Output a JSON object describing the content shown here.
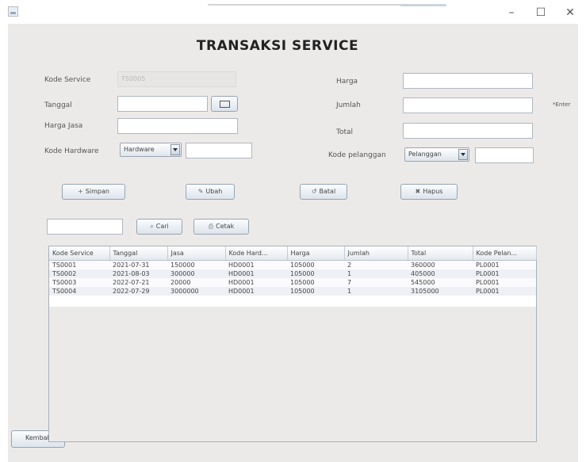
{
  "window": {
    "minimize_label": "–",
    "maximize_label": "☐",
    "close_label": "✕"
  },
  "page_title": "TRANSAKSI SERVICE",
  "form_left": {
    "kode_service": {
      "label": "Kode Service",
      "value": "TS0005"
    },
    "tanggal": {
      "label": "Tanggal",
      "value": ""
    },
    "harga_jasa": {
      "label": "Harga Jasa",
      "value": ""
    },
    "kode_hardware": {
      "label": "Kode Hardware",
      "combo": "Hardware",
      "value": ""
    }
  },
  "form_right": {
    "harga": {
      "label": "Harga",
      "value": ""
    },
    "jumlah": {
      "label": "Jumlah",
      "value": "",
      "hint": "*Enter"
    },
    "total": {
      "label": "Total",
      "value": ""
    },
    "kode_pelanggan": {
      "label": "Kode pelanggan",
      "combo": "Pelanggan",
      "value": ""
    }
  },
  "actions": {
    "simpan": {
      "icon": "+",
      "label": "Simpan"
    },
    "ubah": {
      "icon": "✎",
      "label": "Ubah"
    },
    "batal": {
      "icon": "↺",
      "label": "Batal"
    },
    "hapus": {
      "icon": "✖",
      "label": "Hapus"
    }
  },
  "search": {
    "value": "",
    "cari": {
      "icon": "⌕",
      "label": "Cari"
    },
    "cetak": {
      "icon": "⎙",
      "label": "Cetak"
    }
  },
  "table": {
    "columns": [
      "Kode Service",
      "Tanggal",
      "Jasa",
      "Kode Hard...",
      "Harga",
      "Jumlah",
      "Total",
      "Kode Pelan..."
    ],
    "rows": [
      [
        "TS0001",
        "2021-07-31",
        "150000",
        "HD0001",
        "105000",
        "2",
        "360000",
        "PL0001"
      ],
      [
        "TS0002",
        "2021-08-03",
        "300000",
        "HD0001",
        "105000",
        "1",
        "405000",
        "PL0001"
      ],
      [
        "TS0003",
        "2022-07-21",
        "20000",
        "HD0001",
        "105000",
        "7",
        "545000",
        "PL0001"
      ],
      [
        "TS0004",
        "2022-07-29",
        "3000000",
        "HD0001",
        "105000",
        "1",
        "3105000",
        "PL0001"
      ]
    ]
  },
  "kembali_label": "Kembali",
  "colors": {
    "panel": "#eceae8",
    "field_border": "#aeb7c3",
    "button_top": "#fbfcfe",
    "button_bottom": "#dde4ec"
  }
}
